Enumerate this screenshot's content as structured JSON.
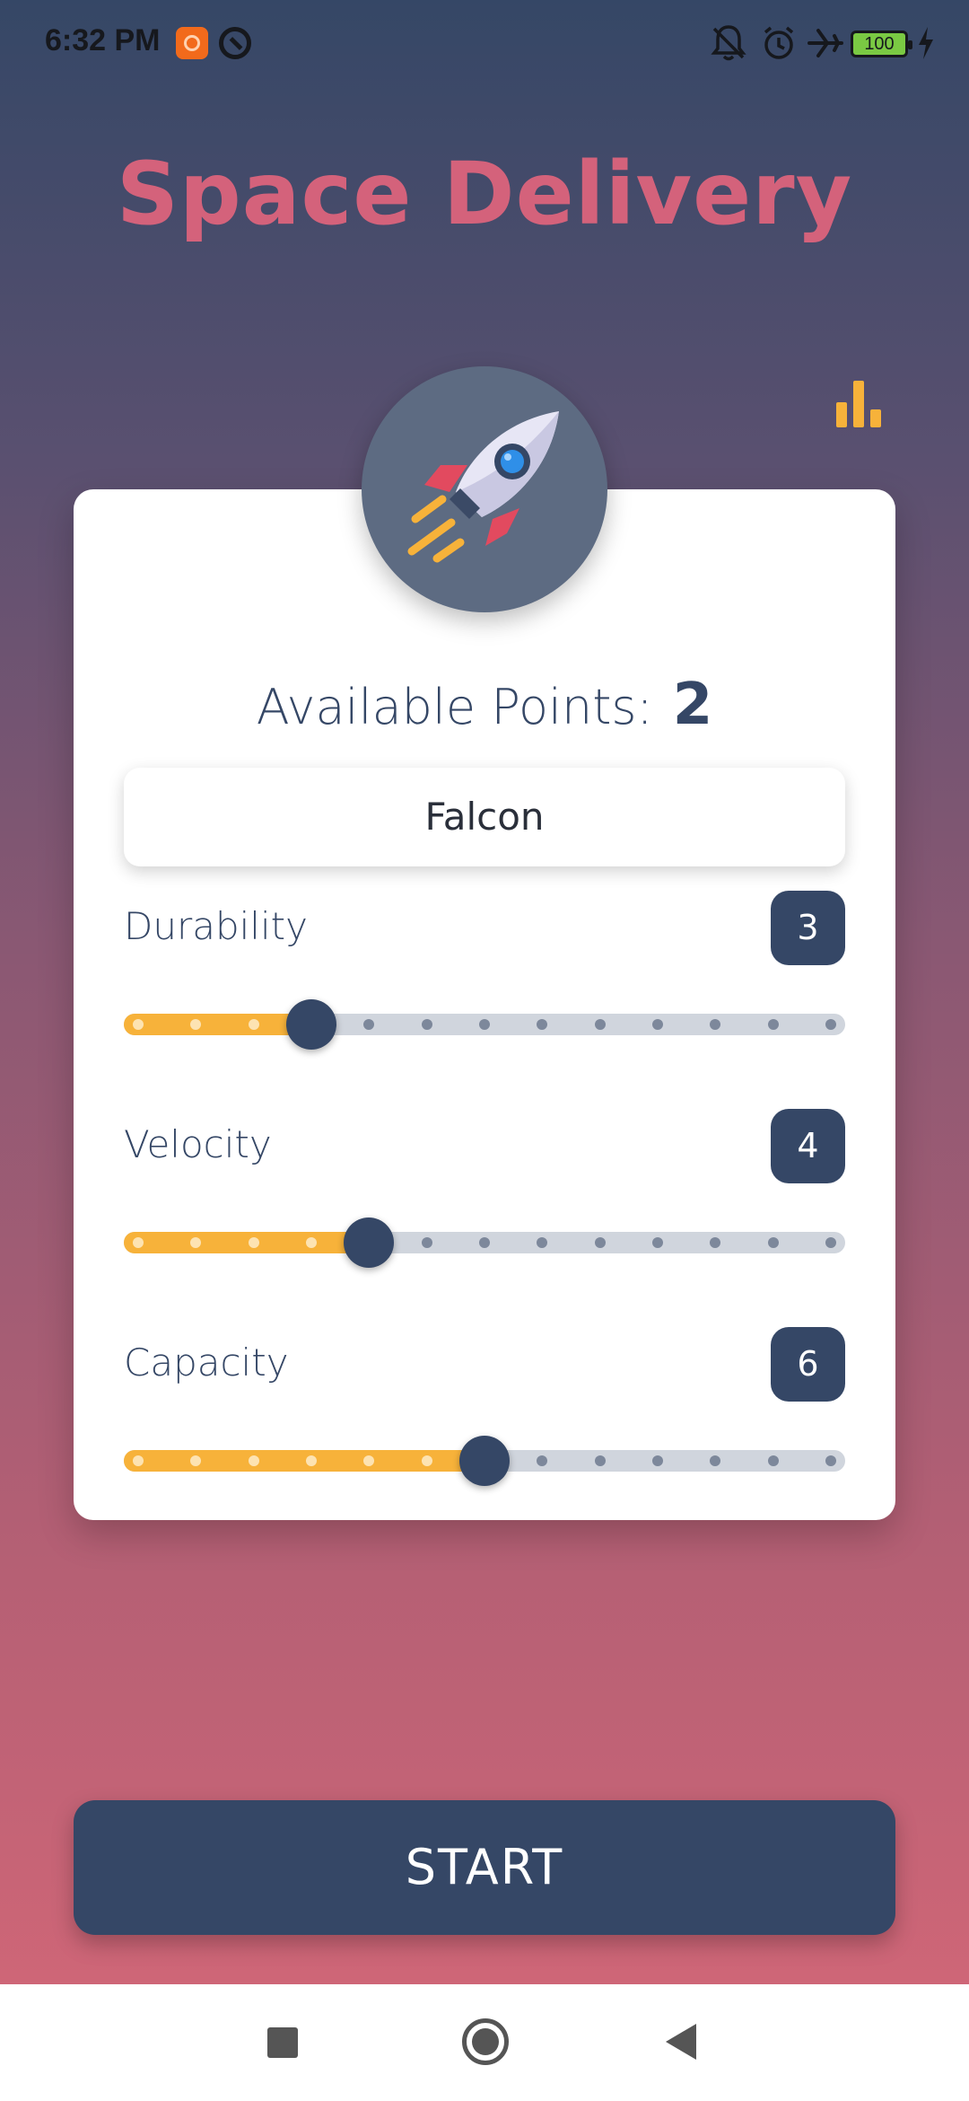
{
  "status_bar": {
    "time": "6:32 PM",
    "battery_level": "100",
    "icons": [
      "app-notification-icon",
      "sync-icon",
      "bell-off-icon",
      "alarm-icon",
      "airplane-mode-icon",
      "battery-icon",
      "charging-icon"
    ]
  },
  "app": {
    "title": "Space Delivery",
    "title_color": "#d4627b",
    "accent_color": "#f7b23a",
    "primary_color": "#354766"
  },
  "header": {
    "stats_icon": "bar-chart-icon"
  },
  "card": {
    "badge_icon": "rocket-icon",
    "points_label": "Available Points:",
    "points_value": "2",
    "ship_name": "Falcon",
    "stats": [
      {
        "label": "Durability",
        "value": "3",
        "level": 3,
        "max": 13
      },
      {
        "label": "Velocity",
        "value": "4",
        "level": 4,
        "max": 13
      },
      {
        "label": "Capacity",
        "value": "6",
        "level": 6,
        "max": 13
      }
    ]
  },
  "actions": {
    "start_label": "START"
  },
  "nav_bar": {
    "icons": [
      "recents-icon",
      "home-icon",
      "back-icon"
    ]
  }
}
